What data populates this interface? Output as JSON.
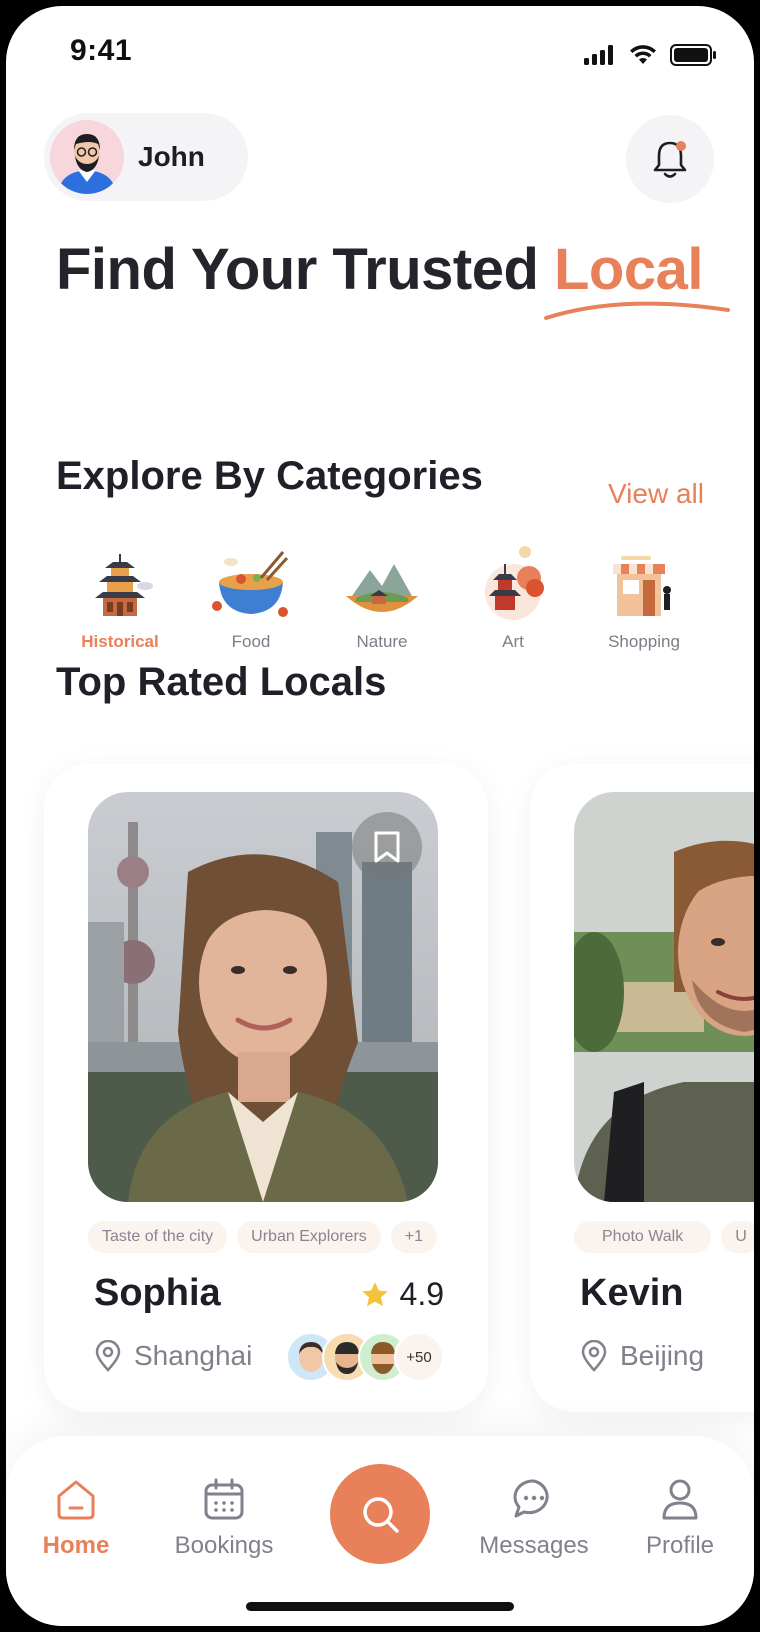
{
  "status_bar": {
    "time": "9:41"
  },
  "user": {
    "name": "John"
  },
  "headline": {
    "text": "Find Your Trusted ",
    "accent": "Local"
  },
  "categories_section": {
    "title": "Explore By Categories",
    "view_all": "View all",
    "items": [
      {
        "label": "Historical",
        "icon": "pagoda-icon",
        "active": true
      },
      {
        "label": "Food",
        "icon": "noodle-bowl-icon",
        "active": false
      },
      {
        "label": "Nature",
        "icon": "mountain-landscape-icon",
        "active": false
      },
      {
        "label": "Art",
        "icon": "art-pagoda-icon",
        "active": false
      },
      {
        "label": "Shopping",
        "icon": "market-stall-icon",
        "active": false
      }
    ]
  },
  "top_rated": {
    "title": "Top Rated Locals",
    "locals": [
      {
        "name": "Sophia",
        "rating": "4.9",
        "location": "Shanghai",
        "tags": [
          "Taste of the city",
          "Urban Explorers",
          "+1"
        ],
        "reviewers_more": "+50"
      },
      {
        "name": "Kevin",
        "location": "Beijing",
        "tags": [
          "Photo Walk",
          "U"
        ]
      }
    ]
  },
  "nav": {
    "items": [
      {
        "label": "Home",
        "icon": "home-icon",
        "active": true
      },
      {
        "label": "Bookings",
        "icon": "calendar-icon",
        "active": false
      },
      {
        "label": "Messages",
        "icon": "chat-icon",
        "active": false
      },
      {
        "label": "Profile",
        "icon": "user-icon",
        "active": false
      }
    ]
  },
  "colors": {
    "accent": "#e8805a",
    "text": "#1f2028",
    "muted": "#7f818b"
  }
}
